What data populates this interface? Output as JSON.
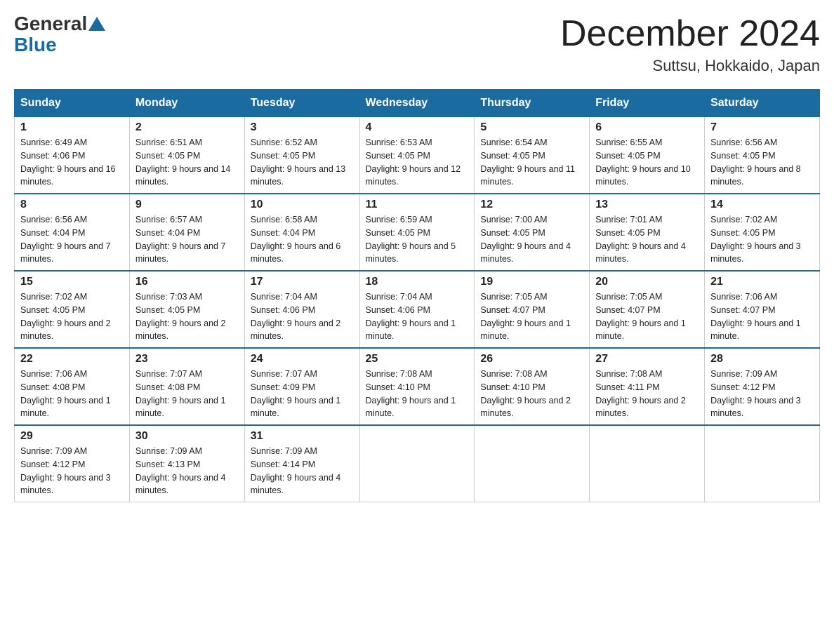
{
  "header": {
    "logo_general": "General",
    "logo_blue": "Blue",
    "month_title": "December 2024",
    "location": "Suttsu, Hokkaido, Japan"
  },
  "days_of_week": [
    "Sunday",
    "Monday",
    "Tuesday",
    "Wednesday",
    "Thursday",
    "Friday",
    "Saturday"
  ],
  "weeks": [
    [
      {
        "day": "1",
        "sunrise": "6:49 AM",
        "sunset": "4:06 PM",
        "daylight": "9 hours and 16 minutes."
      },
      {
        "day": "2",
        "sunrise": "6:51 AM",
        "sunset": "4:05 PM",
        "daylight": "9 hours and 14 minutes."
      },
      {
        "day": "3",
        "sunrise": "6:52 AM",
        "sunset": "4:05 PM",
        "daylight": "9 hours and 13 minutes."
      },
      {
        "day": "4",
        "sunrise": "6:53 AM",
        "sunset": "4:05 PM",
        "daylight": "9 hours and 12 minutes."
      },
      {
        "day": "5",
        "sunrise": "6:54 AM",
        "sunset": "4:05 PM",
        "daylight": "9 hours and 11 minutes."
      },
      {
        "day": "6",
        "sunrise": "6:55 AM",
        "sunset": "4:05 PM",
        "daylight": "9 hours and 10 minutes."
      },
      {
        "day": "7",
        "sunrise": "6:56 AM",
        "sunset": "4:05 PM",
        "daylight": "9 hours and 8 minutes."
      }
    ],
    [
      {
        "day": "8",
        "sunrise": "6:56 AM",
        "sunset": "4:04 PM",
        "daylight": "9 hours and 7 minutes."
      },
      {
        "day": "9",
        "sunrise": "6:57 AM",
        "sunset": "4:04 PM",
        "daylight": "9 hours and 7 minutes."
      },
      {
        "day": "10",
        "sunrise": "6:58 AM",
        "sunset": "4:04 PM",
        "daylight": "9 hours and 6 minutes."
      },
      {
        "day": "11",
        "sunrise": "6:59 AM",
        "sunset": "4:05 PM",
        "daylight": "9 hours and 5 minutes."
      },
      {
        "day": "12",
        "sunrise": "7:00 AM",
        "sunset": "4:05 PM",
        "daylight": "9 hours and 4 minutes."
      },
      {
        "day": "13",
        "sunrise": "7:01 AM",
        "sunset": "4:05 PM",
        "daylight": "9 hours and 4 minutes."
      },
      {
        "day": "14",
        "sunrise": "7:02 AM",
        "sunset": "4:05 PM",
        "daylight": "9 hours and 3 minutes."
      }
    ],
    [
      {
        "day": "15",
        "sunrise": "7:02 AM",
        "sunset": "4:05 PM",
        "daylight": "9 hours and 2 minutes."
      },
      {
        "day": "16",
        "sunrise": "7:03 AM",
        "sunset": "4:05 PM",
        "daylight": "9 hours and 2 minutes."
      },
      {
        "day": "17",
        "sunrise": "7:04 AM",
        "sunset": "4:06 PM",
        "daylight": "9 hours and 2 minutes."
      },
      {
        "day": "18",
        "sunrise": "7:04 AM",
        "sunset": "4:06 PM",
        "daylight": "9 hours and 1 minute."
      },
      {
        "day": "19",
        "sunrise": "7:05 AM",
        "sunset": "4:07 PM",
        "daylight": "9 hours and 1 minute."
      },
      {
        "day": "20",
        "sunrise": "7:05 AM",
        "sunset": "4:07 PM",
        "daylight": "9 hours and 1 minute."
      },
      {
        "day": "21",
        "sunrise": "7:06 AM",
        "sunset": "4:07 PM",
        "daylight": "9 hours and 1 minute."
      }
    ],
    [
      {
        "day": "22",
        "sunrise": "7:06 AM",
        "sunset": "4:08 PM",
        "daylight": "9 hours and 1 minute."
      },
      {
        "day": "23",
        "sunrise": "7:07 AM",
        "sunset": "4:08 PM",
        "daylight": "9 hours and 1 minute."
      },
      {
        "day": "24",
        "sunrise": "7:07 AM",
        "sunset": "4:09 PM",
        "daylight": "9 hours and 1 minute."
      },
      {
        "day": "25",
        "sunrise": "7:08 AM",
        "sunset": "4:10 PM",
        "daylight": "9 hours and 1 minute."
      },
      {
        "day": "26",
        "sunrise": "7:08 AM",
        "sunset": "4:10 PM",
        "daylight": "9 hours and 2 minutes."
      },
      {
        "day": "27",
        "sunrise": "7:08 AM",
        "sunset": "4:11 PM",
        "daylight": "9 hours and 2 minutes."
      },
      {
        "day": "28",
        "sunrise": "7:09 AM",
        "sunset": "4:12 PM",
        "daylight": "9 hours and 3 minutes."
      }
    ],
    [
      {
        "day": "29",
        "sunrise": "7:09 AM",
        "sunset": "4:12 PM",
        "daylight": "9 hours and 3 minutes."
      },
      {
        "day": "30",
        "sunrise": "7:09 AM",
        "sunset": "4:13 PM",
        "daylight": "9 hours and 4 minutes."
      },
      {
        "day": "31",
        "sunrise": "7:09 AM",
        "sunset": "4:14 PM",
        "daylight": "9 hours and 4 minutes."
      },
      null,
      null,
      null,
      null
    ]
  ]
}
